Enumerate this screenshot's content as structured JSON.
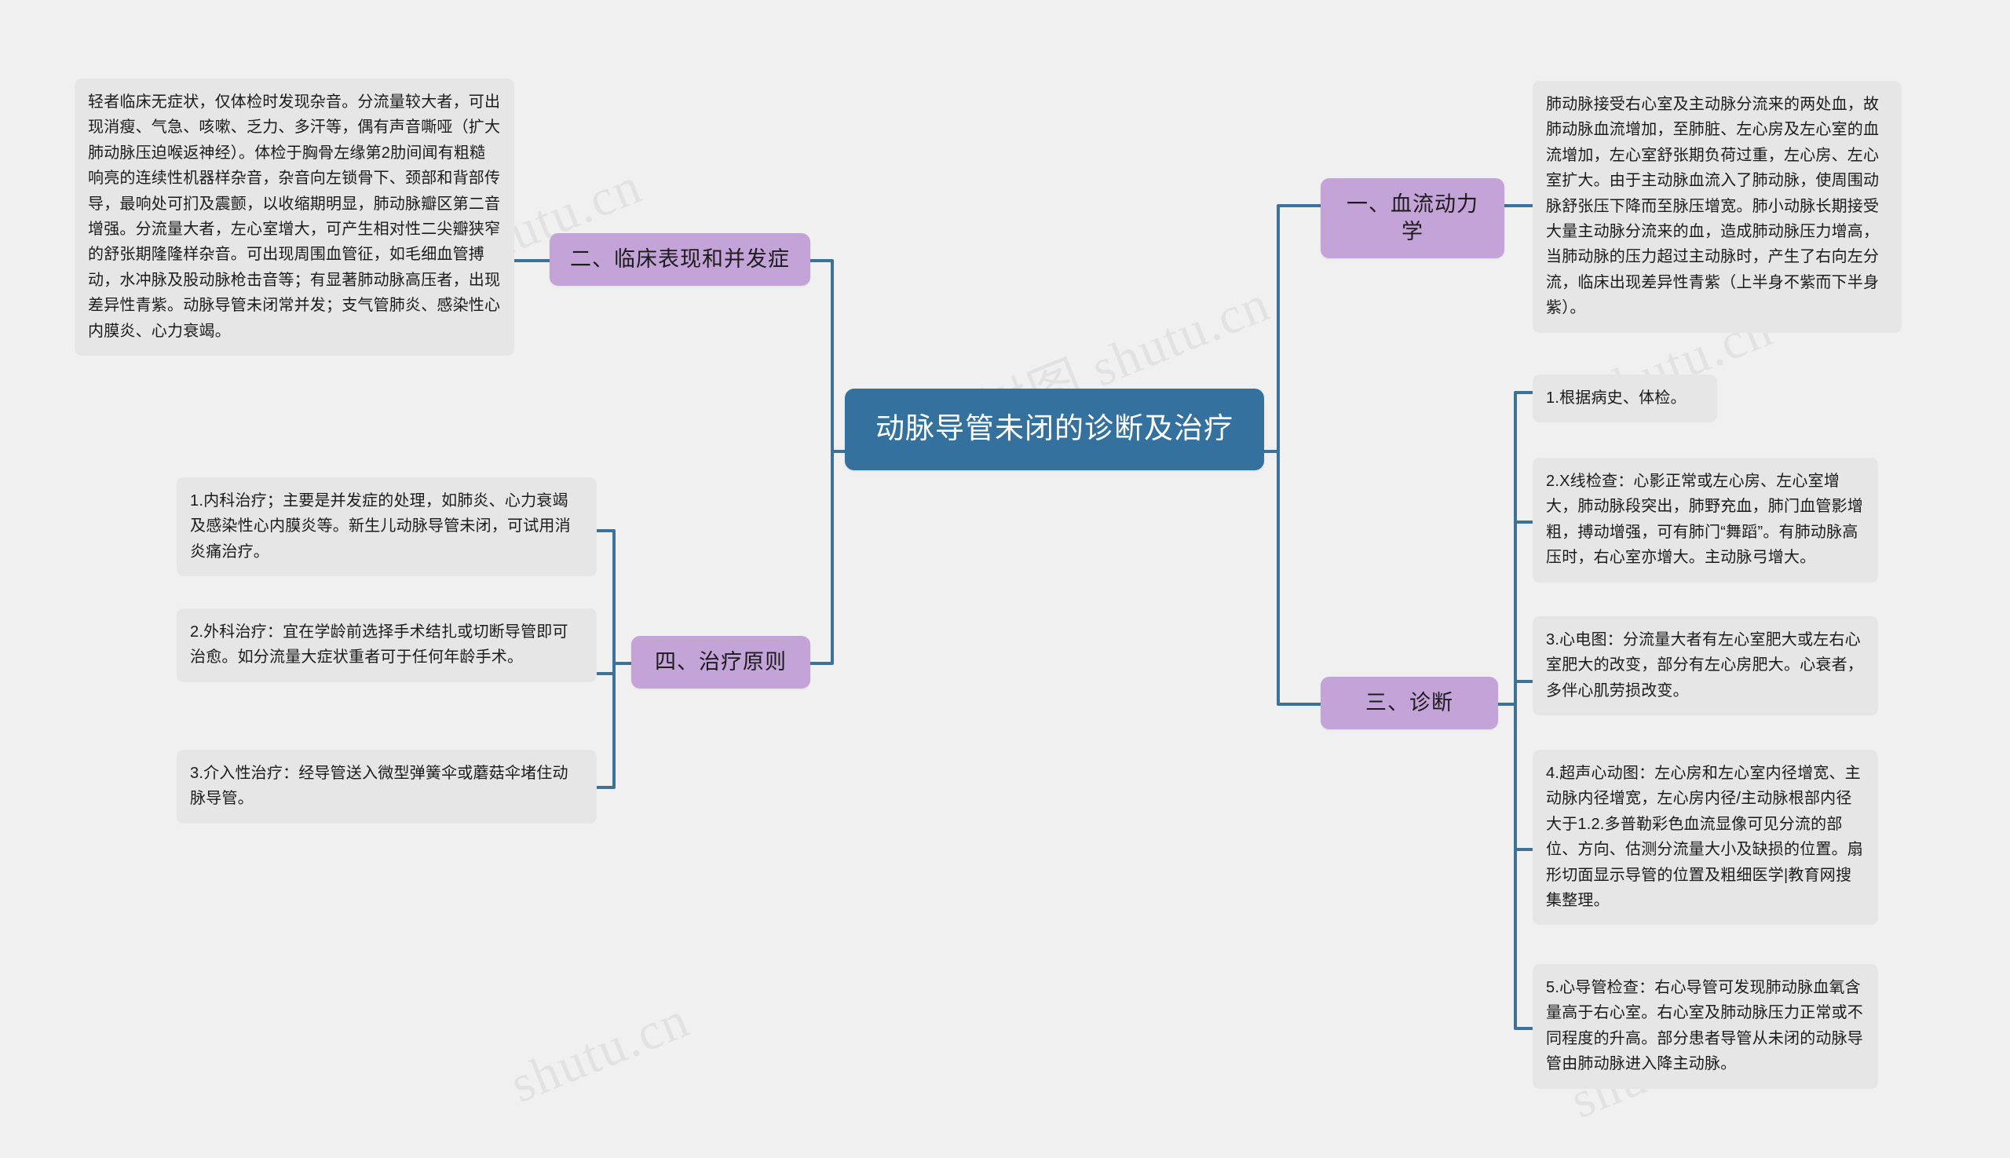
{
  "document": {
    "type": "mindmap",
    "background_color": "#f0f0f0",
    "root_color": "#35719f",
    "branch_color": "#c4a3d8",
    "leaf_color": "#e6e6e6",
    "link_color": "#3d7296"
  },
  "watermarks": [
    {
      "text": "树图 shutu.cn"
    },
    {
      "text": "树图 shutu.cn"
    },
    {
      "text": "shutu.cn"
    },
    {
      "text": "shutu.cn"
    },
    {
      "text": "shutu.cn"
    }
  ],
  "root": {
    "label": "动脉导管未闭的诊断及治疗"
  },
  "branches": {
    "hemodynamics": {
      "label": "一、血流动力学"
    },
    "clinical": {
      "label": "二、临床表现和并发症"
    },
    "diagnosis": {
      "label": "三、诊断"
    },
    "treatment": {
      "label": "四、治疗原则"
    }
  },
  "leaves": {
    "hemodynamics_detail": {
      "text": "肺动脉接受右心室及主动脉分流来的两处血，故肺动脉血流增加，至肺脏、左心房及左心室的血流增加，左心室舒张期负荷过重，左心房、左心室扩大。由于主动脉血流入了肺动脉，使周围动脉舒张压下降而至脉压增宽。肺小动脉长期接受大量主动脉分流来的血，造成肺动脉压力增高，当肺动脉的压力超过主动脉时，产生了右向左分流，临床出现差异性青紫（上半身不紫而下半身紫）。"
    },
    "clinical_detail": {
      "text": "轻者临床无症状，仅体检时发现杂音。分流量较大者，可出现消瘦、气急、咳嗽、乏力、多汗等，偶有声音嘶哑（扩大肺动脉压迫喉返神经）。体检于胸骨左缘第2肋间闻有粗糙响亮的连续性机器样杂音，杂音向左锁骨下、颈部和背部传导，最响处可扪及震颤，以收缩期明显，肺动脉瓣区第二音增强。分流量大者，左心室增大，可产生相对性二尖瓣狭窄的舒张期隆隆样杂音。可出现周围血管征，如毛细血管搏动，水冲脉及股动脉枪击音等；有显著肺动脉高压者，出现差异性青紫。动脉导管未闭常并发；支气管肺炎、感染性心内膜炎、心力衰竭。"
    },
    "diagnosis_items": [
      {
        "text": "1.根据病史、体检。"
      },
      {
        "text": "2.X线检查：心影正常或左心房、左心室增大，肺动脉段突出，肺野充血，肺门血管影增粗，搏动增强，可有肺门“舞蹈”。有肺动脉高压时，右心室亦增大。主动脉弓增大。"
      },
      {
        "text": "3.心电图：分流量大者有左心室肥大或左右心室肥大的改变，部分有左心房肥大。心衰者，多伴心肌劳损改变。"
      },
      {
        "text": "4.超声心动图：左心房和左心室内径增宽、主动脉内径增宽，左心房内径/主动脉根部内径大于1.2.多普勒彩色血流显像可见分流的部位、方向、估测分流量大小及缺损的位置。扇形切面显示导管的位置及粗细医学|教育网搜集整理。"
      },
      {
        "text": "5.心导管检查：右心导管可发现肺动脉血氧含量高于右心室。右心室及肺动脉压力正常或不同程度的升高。部分患者导管从未闭的动脉导管由肺动脉进入降主动脉。"
      }
    ],
    "treatment_items": [
      {
        "text": "1.内科治疗；主要是并发症的处理，如肺炎、心力衰竭及感染性心内膜炎等。新生儿动脉导管未闭，可试用消炎痛治疗。"
      },
      {
        "text": "2.外科治疗：宜在学龄前选择手术结扎或切断导管即可治愈。如分流量大症状重者可于任何年龄手术。"
      },
      {
        "text": "3.介入性治疗：经导管送入微型弹簧伞或蘑菇伞堵住动脉导管。"
      }
    ]
  }
}
